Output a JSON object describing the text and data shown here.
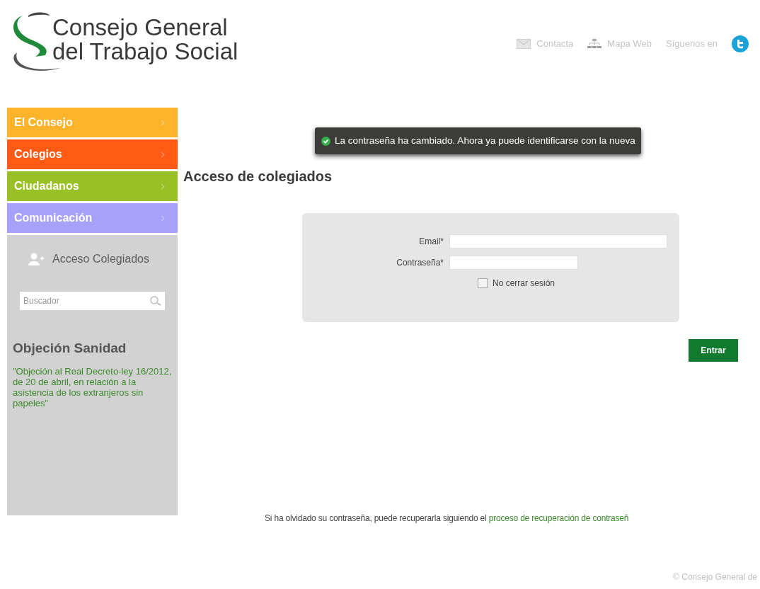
{
  "header": {
    "logo": {
      "line1": "Consejo General",
      "line2": "del Trabajo Social"
    },
    "links": [
      {
        "kind": "mail",
        "label": "Contacta"
      },
      {
        "kind": "sitemap",
        "label": "Mapa Web"
      },
      {
        "kind": "follow",
        "label": "Síguenos en"
      }
    ]
  },
  "sidebar": {
    "menu": [
      {
        "label": "El Consejo",
        "color": "#fbb42a"
      },
      {
        "label": "Colegios",
        "color": "#ff5a14"
      },
      {
        "label": "Ciudadanos",
        "color": "#99c024"
      },
      {
        "label": "Comunicación",
        "color": "#a8a1fb"
      }
    ],
    "access_link": "Acceso Colegiados",
    "search": {
      "placeholder": "Buscador"
    },
    "news": {
      "title": "Objeción Sanidad",
      "text": "\"Objeción al Real Decreto-ley 16/2012, de 20 de abril, en relación a la asistencia de los extranjeros sin papeles\""
    }
  },
  "notification": "La contraseña ha cambiado. Ahora ya puede identificarse con la nueva",
  "page_title": "Acceso de colegiados",
  "form": {
    "fields": [
      {
        "label": "Email*",
        "kind": "email"
      },
      {
        "label": "Contraseña*",
        "kind": "password"
      }
    ],
    "remember": {
      "label": "No cerrar sesión",
      "checked": false
    },
    "submit": "Entrar"
  },
  "recovery": {
    "text": "Si ha olvidado su contraseña, puede recuperarla siguiendo el",
    "link": "proceso de recuperación de contraseñ"
  },
  "footer": "© Consejo General de"
}
